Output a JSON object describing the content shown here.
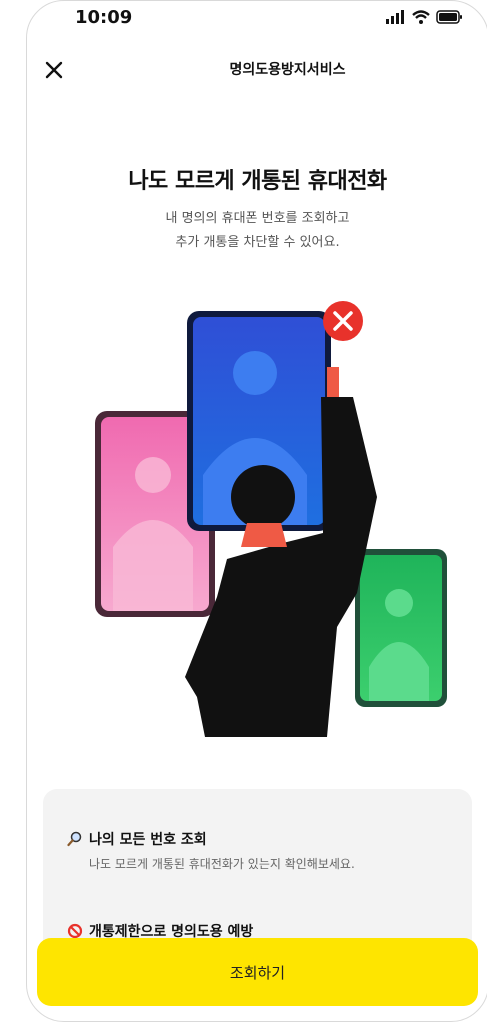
{
  "status_bar": {
    "time": "10:09",
    "icons": [
      "signal-icon",
      "wifi-icon",
      "battery-icon"
    ]
  },
  "header": {
    "title": "명의도용방지서비스",
    "close_icon": "close-icon"
  },
  "hero": {
    "headline": "나도 모르게 개통된 휴대전화",
    "sub_line1": "내 명의의 휴대폰 번호를 조회하고",
    "sub_line2": "추가 개통을 차단할 수 있어요."
  },
  "features": [
    {
      "icon": "magnifier-icon",
      "title": "나의 모든 번호 조회",
      "desc": "나도 모르게 개통된 휴대전화가 있는지 확인해보세요."
    },
    {
      "icon": "prohibited-icon",
      "title": "개통제한으로 명의도용 예방",
      "desc": ""
    }
  ],
  "cta": {
    "label": "조회하기"
  },
  "colors": {
    "accent_yellow": "#FEE500",
    "card_bg": "#F3F3F3"
  }
}
